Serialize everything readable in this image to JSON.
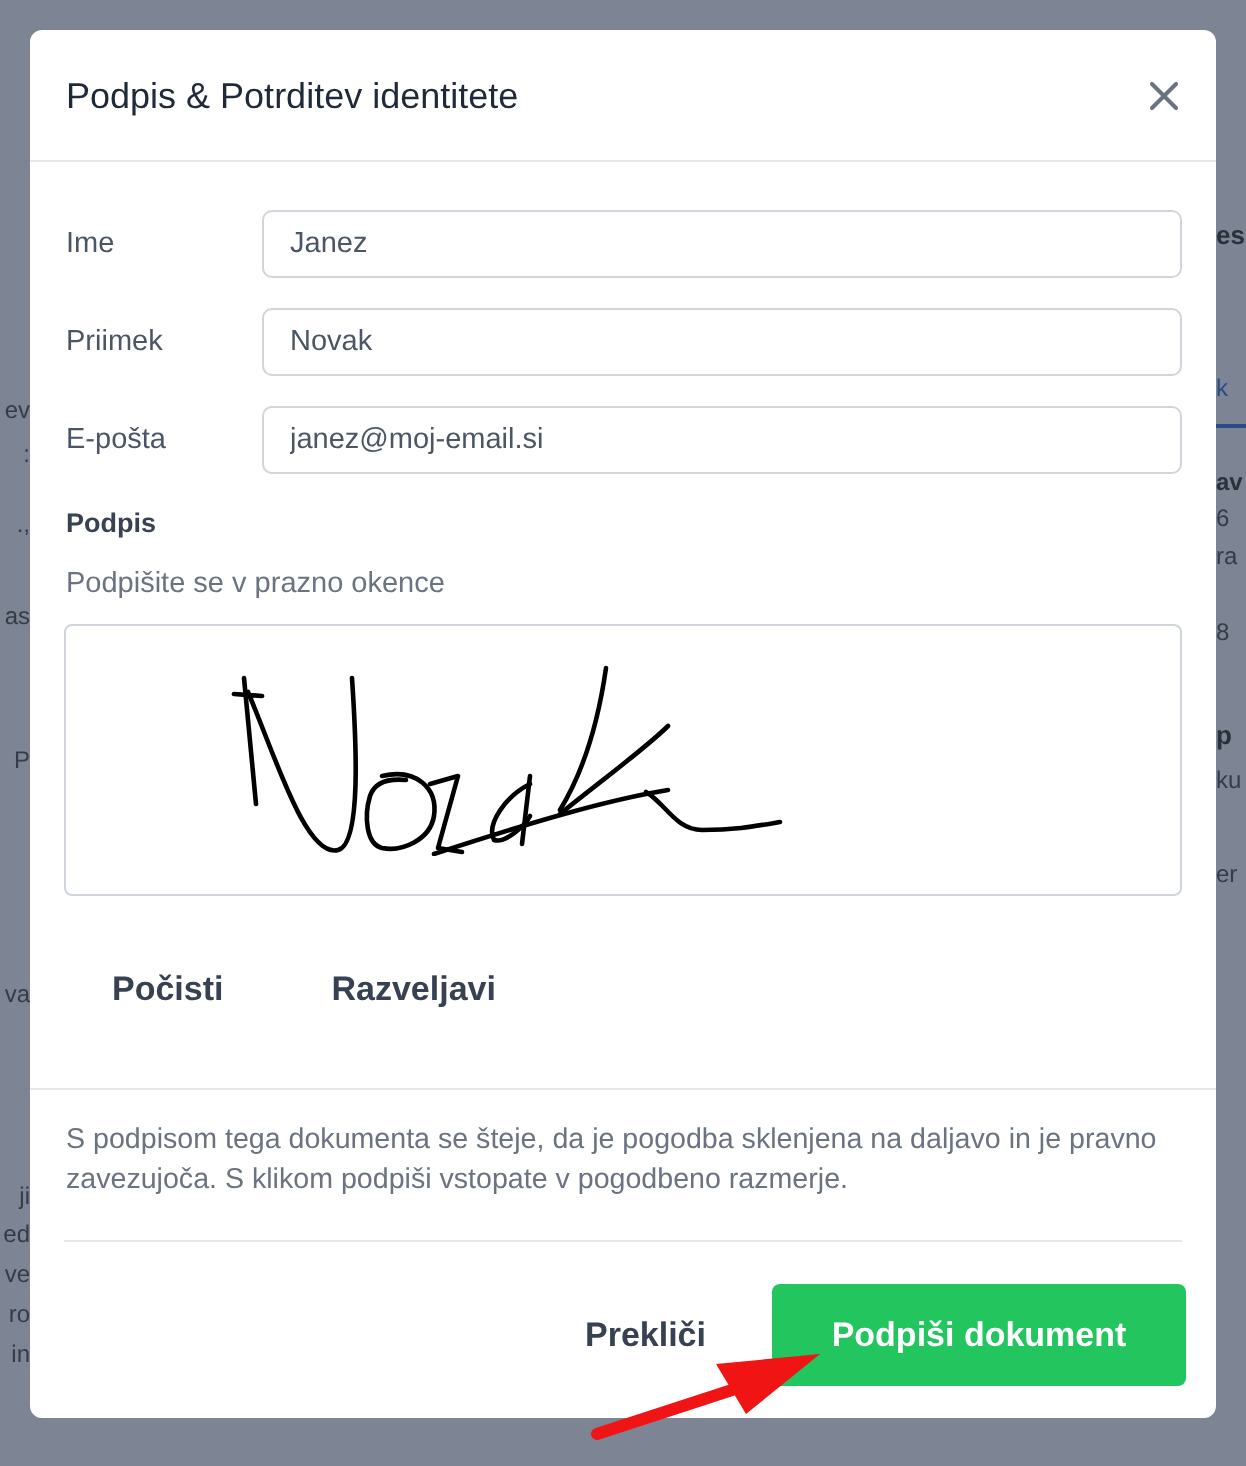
{
  "backdrop": {
    "left": [
      {
        "text": "ev",
        "kind": "text"
      },
      {
        "text": ":",
        "kind": "text"
      },
      {
        "text": ".,",
        "kind": "text"
      },
      {
        "text": "as",
        "kind": "text"
      },
      {
        "text": "P",
        "kind": "text"
      },
      {
        "text": "va",
        "kind": "text"
      },
      {
        "text": "ji",
        "kind": "text"
      },
      {
        "text": "ed",
        "kind": "text"
      },
      {
        "text": "ve",
        "kind": "text"
      },
      {
        "text": "ro",
        "kind": "text"
      },
      {
        "text": "in",
        "kind": "text"
      }
    ],
    "right": [
      {
        "text": "es",
        "kind": "heading"
      },
      {
        "text": "k",
        "kind": "tab"
      },
      {
        "text": "av",
        "kind": "bold"
      },
      {
        "text": "6",
        "kind": "text"
      },
      {
        "text": "ra",
        "kind": "text"
      },
      {
        "text": "8",
        "kind": "text"
      },
      {
        "text": "p",
        "kind": "heading"
      },
      {
        "text": "ku",
        "kind": "text"
      },
      {
        "text": "er",
        "kind": "text"
      }
    ]
  },
  "dialog": {
    "title": "Podpis & Potrditev identitete",
    "fields": [
      {
        "label": "Ime",
        "value": "Janez"
      },
      {
        "label": "Priimek",
        "value": "Novak"
      },
      {
        "label": "E-pošta",
        "value": "janez@moj-email.si"
      }
    ],
    "signature": {
      "label": "Podpis",
      "hint": "Podpišite se v prazno okence",
      "signed": true,
      "actions": [
        "Počisti",
        "Razveljavi"
      ]
    },
    "notice": "S podpisom tega dokumenta se šteje, da je pogodba sklenjena na daljavo in je pravno zavezujoča. S klikom podpiši vstopate v pogodbeno razmerje.",
    "buttons": [
      {
        "label": "Prekliči",
        "kind": "secondary"
      },
      {
        "label": "Podpiši dokument",
        "kind": "primary"
      }
    ]
  },
  "annotation": {
    "kind": "arrow"
  }
}
